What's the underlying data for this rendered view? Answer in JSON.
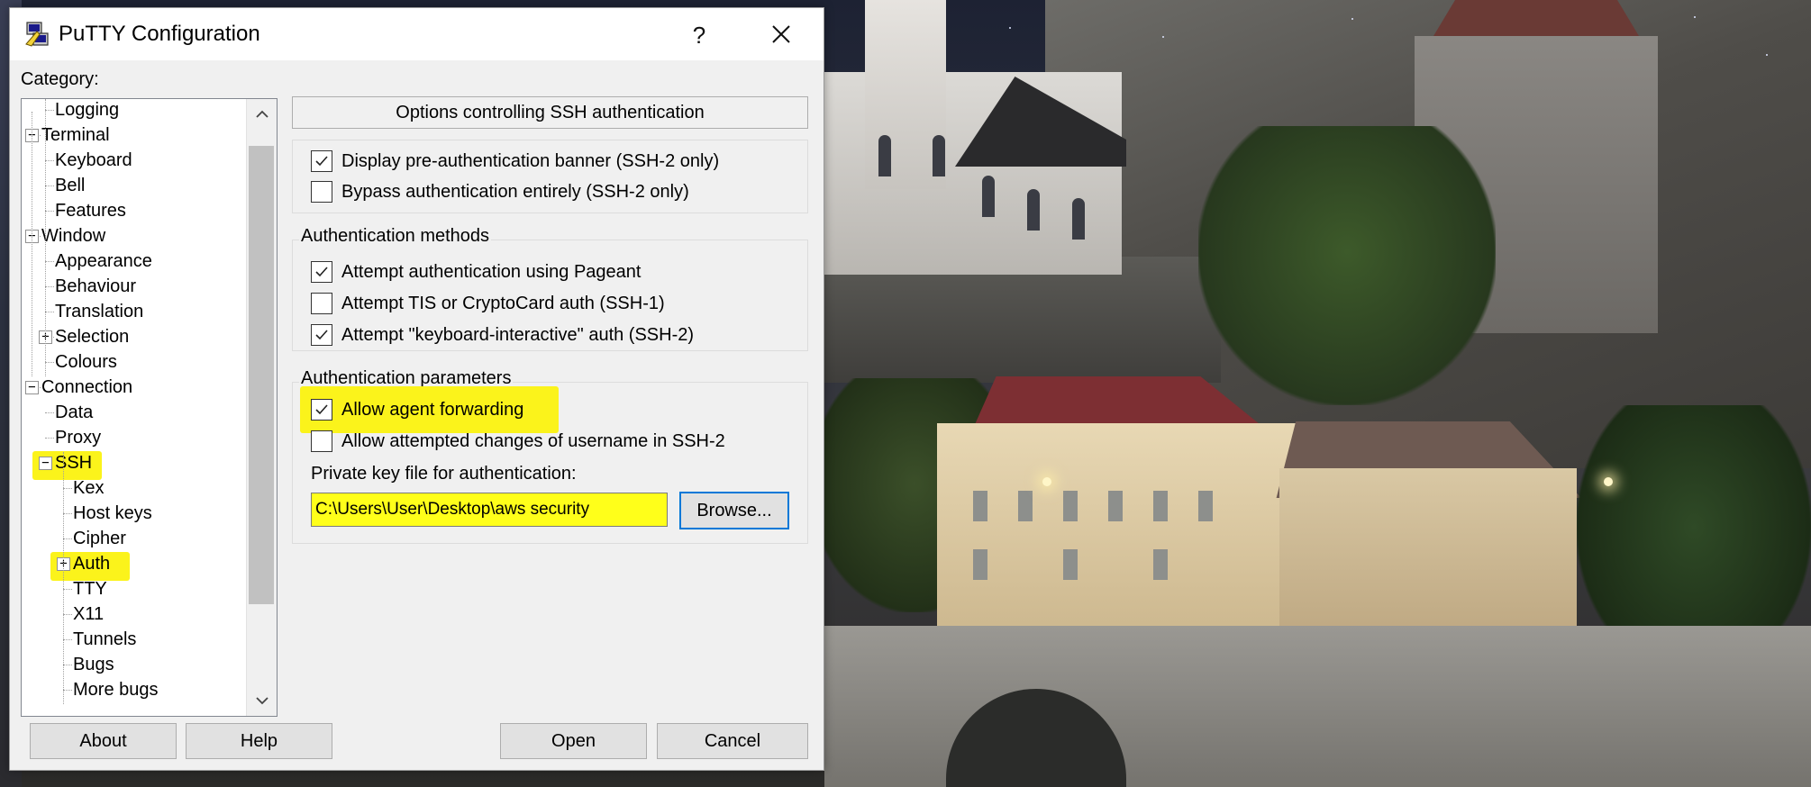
{
  "window": {
    "title": "PuTTY Configuration",
    "help_glyph": "?",
    "icon": "putty-icon"
  },
  "category": {
    "label": "Category:",
    "items": [
      {
        "label": "Logging",
        "depth": 1
      },
      {
        "label": "Terminal",
        "depth": 0,
        "expander": "−"
      },
      {
        "label": "Keyboard",
        "depth": 1
      },
      {
        "label": "Bell",
        "depth": 1
      },
      {
        "label": "Features",
        "depth": 1
      },
      {
        "label": "Window",
        "depth": 0,
        "expander": "−"
      },
      {
        "label": "Appearance",
        "depth": 1
      },
      {
        "label": "Behaviour",
        "depth": 1
      },
      {
        "label": "Translation",
        "depth": 1
      },
      {
        "label": "Selection",
        "depth": 1,
        "expander": "+"
      },
      {
        "label": "Colours",
        "depth": 1
      },
      {
        "label": "Connection",
        "depth": 0,
        "expander": "−"
      },
      {
        "label": "Data",
        "depth": 1
      },
      {
        "label": "Proxy",
        "depth": 1
      },
      {
        "label": "SSH",
        "depth": 1,
        "expander": "−",
        "highlighted": true
      },
      {
        "label": "Kex",
        "depth": 2
      },
      {
        "label": "Host keys",
        "depth": 2
      },
      {
        "label": "Cipher",
        "depth": 2
      },
      {
        "label": "Auth",
        "depth": 2,
        "expander": "+",
        "highlighted": true,
        "selected": true
      },
      {
        "label": "TTY",
        "depth": 2
      },
      {
        "label": "X11",
        "depth": 2
      },
      {
        "label": "Tunnels",
        "depth": 2
      },
      {
        "label": "Bugs",
        "depth": 2
      },
      {
        "label": "More bugs",
        "depth": 2
      }
    ]
  },
  "panel": {
    "header": "Options controlling SSH authentication",
    "banner_group": {
      "options": [
        {
          "label": "Display pre-authentication banner (SSH-2 only)",
          "checked": true
        },
        {
          "label": "Bypass authentication entirely (SSH-2 only)",
          "checked": false
        }
      ]
    },
    "methods_group": {
      "title": "Authentication methods",
      "options": [
        {
          "label": "Attempt authentication using Pageant",
          "checked": true
        },
        {
          "label": "Attempt TIS or CryptoCard auth (SSH-1)",
          "checked": false
        },
        {
          "label": "Attempt \"keyboard-interactive\" auth (SSH-2)",
          "checked": true
        }
      ]
    },
    "params_group": {
      "title": "Authentication parameters",
      "options": [
        {
          "label": "Allow agent forwarding",
          "checked": true,
          "highlighted": true
        },
        {
          "label": "Allow attempted changes of username in SSH-2",
          "checked": false
        }
      ],
      "keyfile_label": "Private key file for authentication:",
      "keyfile_value": "C:\\Users\\User\\Desktop\\aws security",
      "browse_label": "Browse..."
    }
  },
  "footer": {
    "about_label": "About",
    "help_label": "Help",
    "open_label": "Open",
    "cancel_label": "Cancel"
  },
  "colors": {
    "highlight": "#ffff1a",
    "dialog_bg": "#f0f0f0",
    "focus_border": "#0078d7"
  }
}
